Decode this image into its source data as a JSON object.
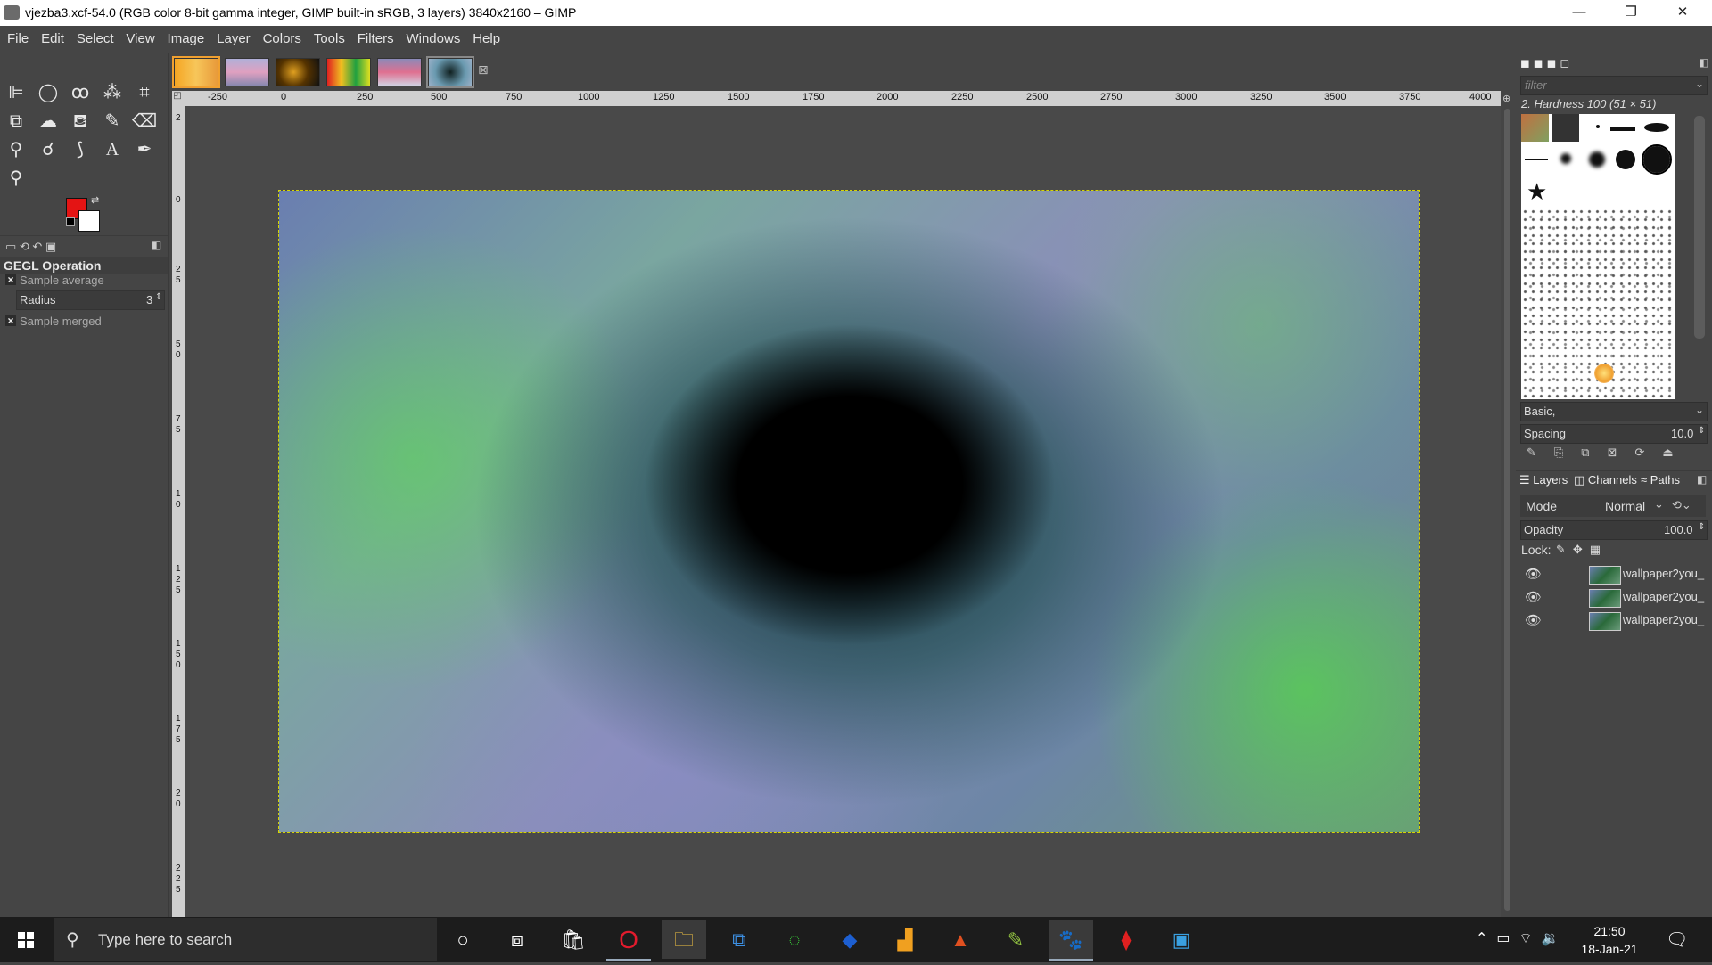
{
  "window": {
    "title": "vjezba3.xcf-54.0 (RGB color 8-bit gamma integer, GIMP built-in sRGB, 3 layers) 3840x2160 – GIMP",
    "minimize": "—",
    "maximize": "❐",
    "close": "✕"
  },
  "menu": [
    "File",
    "Edit",
    "Select",
    "View",
    "Image",
    "Layer",
    "Colors",
    "Tools",
    "Filters",
    "Windows",
    "Help"
  ],
  "image_tabs_close": "⊠",
  "ruler": {
    "h_ticks": [
      "-250",
      "0",
      "250",
      "500",
      "750",
      "1000",
      "1250",
      "1500",
      "1750",
      "2000",
      "2250",
      "2500",
      "2750",
      "3000",
      "3250",
      "3500",
      "3750",
      "4000"
    ],
    "v_ticks": [
      "2",
      "0",
      "2",
      "5",
      "5",
      "0",
      "7",
      "5",
      "1",
      "0",
      "1",
      "2",
      "5",
      "1",
      "5",
      "0",
      "1",
      "7",
      "5",
      "2",
      "0",
      "2",
      "2",
      "5"
    ]
  },
  "tool_options": {
    "header": "GEGL Operation",
    "sample_average": "Sample average",
    "radius_label": "Radius",
    "radius_value": "3",
    "sample_merged": "Sample merged",
    "check": "×"
  },
  "colors": {
    "foreground": "#e41414",
    "background": "#ffffff"
  },
  "brushes": {
    "filter_placeholder": "filter",
    "selected_brush": "2. Hardness 100 (51 × 51)",
    "tag": "Basic,",
    "spacing_label": "Spacing",
    "spacing_value": "10.0"
  },
  "layers_panel": {
    "tabs": [
      "Layers",
      "Channels",
      "Paths"
    ],
    "mode_label": "Mode",
    "mode_value": "Normal",
    "opacity_label": "Opacity",
    "opacity_value": "100.0",
    "lock_label": "Lock:",
    "layers": [
      {
        "name": "wallpaper2you_"
      },
      {
        "name": "wallpaper2you_"
      },
      {
        "name": "wallpaper2you_"
      }
    ]
  },
  "taskbar": {
    "search_placeholder": "Type here to search",
    "time": "21:50",
    "date": "18-Jan-21"
  }
}
